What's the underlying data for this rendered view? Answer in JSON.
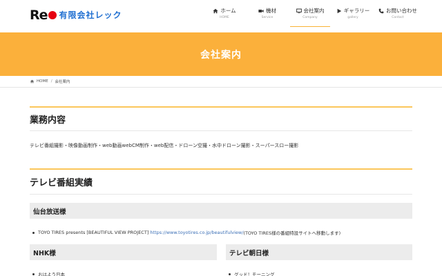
{
  "header": {
    "logo_text": "Re",
    "company_name": "有限会社レック",
    "nav": [
      {
        "label": "ホーム",
        "sub": "HOME",
        "icon": "home-icon"
      },
      {
        "label": "機材",
        "sub": "Service",
        "icon": "video-camera-icon"
      },
      {
        "label": "会社案内",
        "sub": "Company",
        "icon": "monitor-icon"
      },
      {
        "label": "ギャラリー",
        "sub": "gallery",
        "icon": "play-icon"
      },
      {
        "label": "お問い合わせ",
        "sub": "Contact",
        "icon": "phone-icon"
      }
    ]
  },
  "banner": {
    "title": "会社案内"
  },
  "breadcrumb": {
    "home": "HOME",
    "separator": "/",
    "current": "会社案内"
  },
  "business": {
    "heading": "業務内容",
    "text": "テレビ番組撮影・映像動画制作・web動画webCM制作・web配信・ドローン空撮・水中ドローン撮影・スーパースロー撮影"
  },
  "tv": {
    "heading": "テレビ番組実績",
    "sendai": {
      "title": "仙台放送様",
      "item_prefix": "TOYO TIRES presents [BEAUTIFUL VIEW PROJECT] ",
      "item_link": "https://www.toyotires.co.jp/beautifulview/",
      "item_suffix": "(TOYO TIRES様の番組特設サイトへ移動します)"
    },
    "nhk": {
      "title": "NHK様",
      "item": "おはよう日本"
    },
    "asahi": {
      "title": "テレビ朝日様",
      "item": "グッド！モーニング"
    }
  },
  "colors": {
    "accent": "#fbb03b",
    "logo_red": "#e60012",
    "logo_blue": "#1f6fd1",
    "link": "#3b6fb6"
  }
}
